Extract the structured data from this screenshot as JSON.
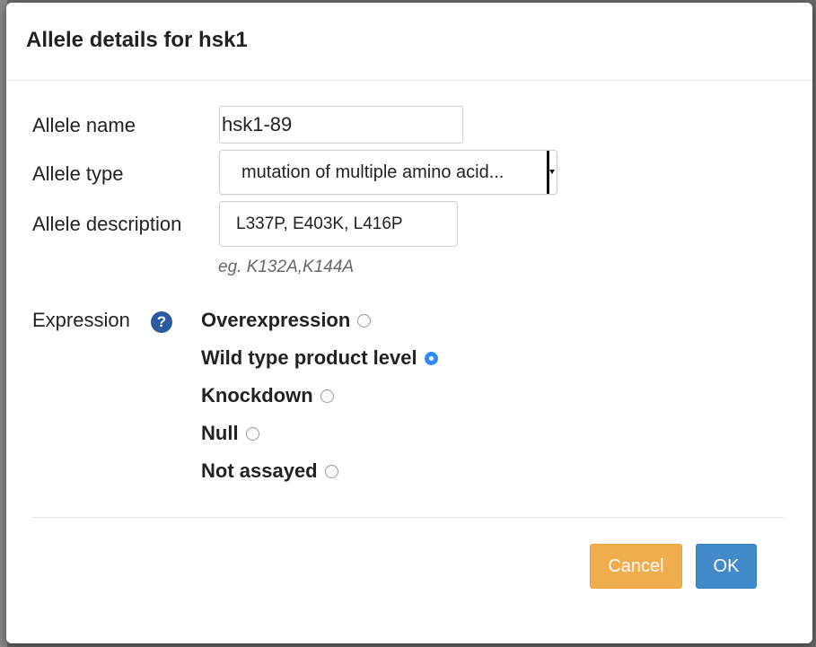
{
  "dialog": {
    "title": "Allele details for hsk1"
  },
  "fields": {
    "name_label": "Allele name",
    "name_value": "hsk1-89",
    "type_label": "Allele type",
    "type_value": "mutation of multiple amino acid...",
    "description_label": "Allele description",
    "description_value": "L337P, E403K, L416P",
    "description_hint": "eg. K132A,K144A"
  },
  "expression": {
    "label": "Expression",
    "help_icon": "question-circle-icon",
    "options": [
      {
        "label": "Overexpression",
        "checked": false
      },
      {
        "label": "Wild type product level",
        "checked": true
      },
      {
        "label": "Knockdown",
        "checked": false
      },
      {
        "label": "Null",
        "checked": false
      },
      {
        "label": "Not assayed",
        "checked": false
      }
    ]
  },
  "buttons": {
    "cancel_label": "Cancel",
    "ok_label": "OK"
  },
  "colors": {
    "cancel_bg": "#f0ad4e",
    "ok_bg": "#428bca",
    "radio_checked": "#2f8df5",
    "help_icon": "#2c5aa0"
  }
}
